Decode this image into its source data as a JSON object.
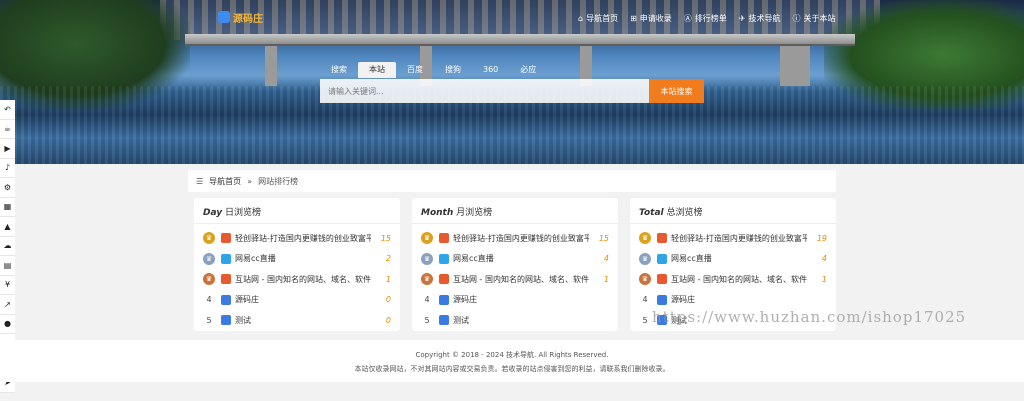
{
  "brand": {
    "name": "源码庄"
  },
  "topnav": [
    {
      "icon": "home-icon",
      "glyph": "⌂",
      "label": "导航首页"
    },
    {
      "icon": "plus-square-icon",
      "glyph": "⊞",
      "label": "申请收录"
    },
    {
      "icon": "ranking-icon",
      "glyph": "Ⓐ",
      "label": "排行榜单"
    },
    {
      "icon": "compass-icon",
      "glyph": "✈",
      "label": "技术导航"
    },
    {
      "icon": "info-icon",
      "glyph": "ⓘ",
      "label": "关于本站"
    }
  ],
  "search": {
    "tabs": [
      "搜索",
      "本站",
      "百度",
      "搜狗",
      "360",
      "必应"
    ],
    "active_tab": 1,
    "placeholder": "请输入关键词...",
    "button": "本站搜索"
  },
  "sidebar": [
    {
      "icon": "undo-icon",
      "glyph": "↶"
    },
    {
      "icon": "coffee-icon",
      "glyph": "☕"
    },
    {
      "icon": "video-icon",
      "glyph": "▶"
    },
    {
      "icon": "music-icon",
      "glyph": "♪"
    },
    {
      "icon": "cubes-icon",
      "glyph": "⚙"
    },
    {
      "icon": "apps-icon",
      "glyph": "▦"
    },
    {
      "icon": "graduation-cap-icon",
      "glyph": "▲"
    },
    {
      "icon": "cloud-icon",
      "glyph": "☁"
    },
    {
      "icon": "file-icon",
      "glyph": "▤"
    },
    {
      "icon": "yen-icon",
      "glyph": "¥"
    },
    {
      "icon": "chart-line-icon",
      "glyph": "↗"
    },
    {
      "icon": "record-icon",
      "glyph": "●"
    },
    {
      "icon": "heartbeat-icon",
      "glyph": "♥"
    },
    {
      "icon": "chrome-icon",
      "glyph": "◎"
    },
    {
      "icon": "paper-plane-icon",
      "glyph": "➤"
    }
  ],
  "breadcrumb": {
    "icon": "menu-icon",
    "glyph": "☰",
    "home": "导航首页",
    "sep": "»",
    "current": "网站排行榜"
  },
  "cards": [
    {
      "prefix": "Day",
      "title": "日浏览榜",
      "rows": [
        {
          "rank": "1",
          "site": "轻创驿站-打造国内更赚钱的创业致富平...",
          "count": "15"
        },
        {
          "rank": "2",
          "site": "网易cc直播",
          "count": "2"
        },
        {
          "rank": "3",
          "site": "互站网 - 国内知名的网站、域名、软件、...",
          "count": "1"
        },
        {
          "rank": "4",
          "site": "源码庄",
          "count": "0"
        },
        {
          "rank": "5",
          "site": "测试",
          "count": "0"
        }
      ]
    },
    {
      "prefix": "Month",
      "title": "月浏览榜",
      "rows": [
        {
          "rank": "1",
          "site": "轻创驿站-打造国内更赚钱的创业致富平...",
          "count": "15"
        },
        {
          "rank": "2",
          "site": "网易cc直播",
          "count": "4"
        },
        {
          "rank": "3",
          "site": "互站网 - 国内知名的网站、域名、软件、...",
          "count": "1"
        },
        {
          "rank": "4",
          "site": "源码庄",
          "count": ""
        },
        {
          "rank": "5",
          "site": "测试",
          "count": ""
        }
      ]
    },
    {
      "prefix": "Total",
      "title": "总浏览榜",
      "rows": [
        {
          "rank": "1",
          "site": "轻创驿站-打造国内更赚钱的创业致富平...",
          "count": "19"
        },
        {
          "rank": "2",
          "site": "网易cc直播",
          "count": "4"
        },
        {
          "rank": "3",
          "site": "互站网 - 国内知名的网站、域名、软件、...",
          "count": "1"
        },
        {
          "rank": "4",
          "site": "源码庄",
          "count": ""
        },
        {
          "rank": "5",
          "site": "测试",
          "count": ""
        }
      ]
    }
  ],
  "footer": {
    "copyright": "Copyright © 2018 - 2024 技术导航. All Rights Reserved.",
    "notice": "本站仅收录网站，不对其网站内容或交易负责。若收录的站点侵害到您的利益，请联系我们删除收录。"
  },
  "watermark": "https://www.huzhan.com/ishop17025",
  "colors": {
    "accent": "#f07c1d",
    "count": "#e68a00",
    "medal_gold": "#d9a21f",
    "medal_silver": "#8aa0c0",
    "medal_bronze": "#c9743a"
  },
  "site_icons": [
    "#e9592f",
    "#2fa4e7",
    "#e9592f",
    "#3b7ae0",
    "#3b7ae0"
  ]
}
